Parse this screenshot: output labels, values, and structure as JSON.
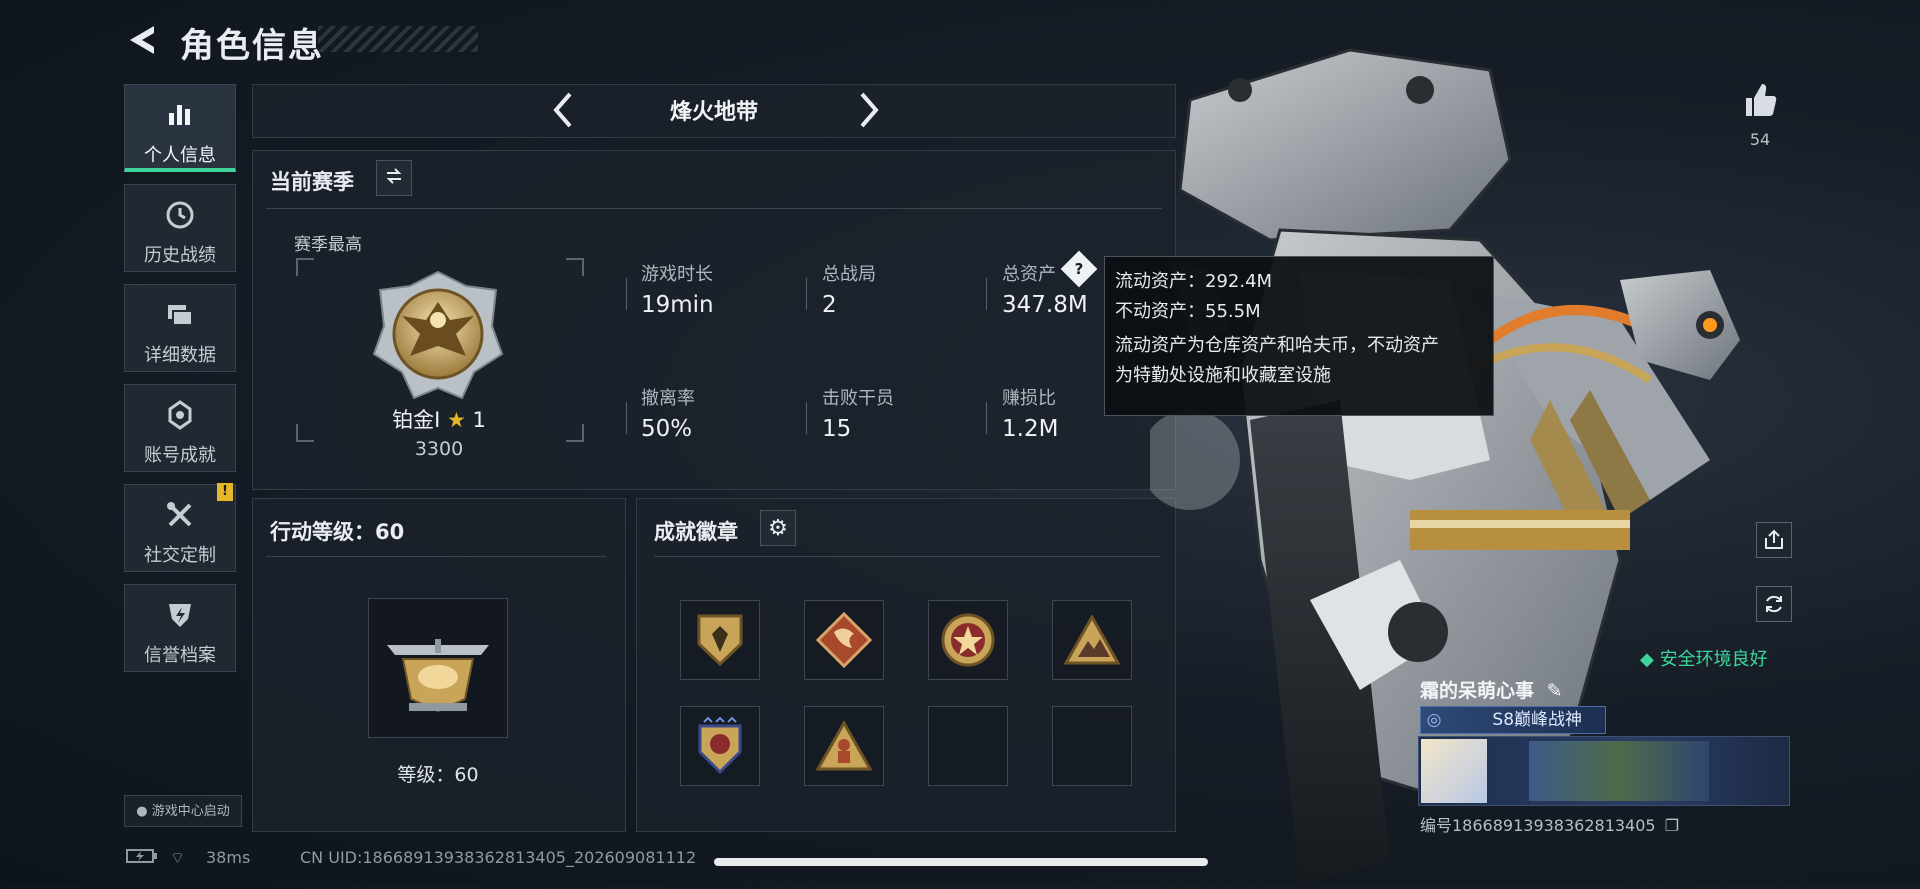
{
  "header": {
    "title": "角色信息"
  },
  "nav": [
    {
      "label": "个人信息",
      "icon": "bar-chart-icon",
      "active": true
    },
    {
      "label": "历史战绩",
      "icon": "clock-icon"
    },
    {
      "label": "详细数据",
      "icon": "folders-icon"
    },
    {
      "label": "账号成就",
      "icon": "emblem-icon"
    },
    {
      "label": "社交定制",
      "icon": "tools-icon",
      "badge": "!"
    },
    {
      "label": "信誉档案",
      "icon": "shield-bolt-icon"
    }
  ],
  "game_center": "游戏中心启动",
  "mode": {
    "name": "烽火地带"
  },
  "season": {
    "title": "当前赛季",
    "best_label": "赛季最高",
    "rank_name": "铂金I",
    "rank_stars": "1",
    "rank_score": "3300",
    "stats": [
      {
        "label": "游戏时长",
        "value": "19min"
      },
      {
        "label": "总战局",
        "value": "2"
      },
      {
        "label": "总资产",
        "value": "347.8M"
      },
      {
        "label": "撤离率",
        "value": "50%"
      },
      {
        "label": "击败干员",
        "value": "15"
      },
      {
        "label": "赚损比",
        "value": "1.2M"
      }
    ]
  },
  "tooltip": {
    "line1": "流动资产：292.4M",
    "line2": "不动资产：55.5M",
    "line3": "流动资产为仓库资产和哈夫币，不动资产",
    "line4": "为特勤处设施和收藏室设施"
  },
  "action_level": {
    "title": "行动等级：60",
    "level_text": "等级：60"
  },
  "achievements": {
    "title": "成就徽章",
    "badges": [
      "shield-badge",
      "dragon-badge",
      "star-badge",
      "mountain-badge",
      "wing-badge",
      "soldier-badge",
      "",
      ""
    ]
  },
  "likes": {
    "count": "54"
  },
  "safety": {
    "text": "安全环境良好"
  },
  "player": {
    "name": "霜的呆萌心事",
    "title": "S8巅峰战神",
    "id": "编号18668913938362813405"
  },
  "status_bar": {
    "ping": "38ms",
    "uid": "CN UID:18668913938362813405_202609081112"
  },
  "colors": {
    "accent": "#3cd69c",
    "warning": "#e6b62a",
    "gold": "#c9a55a"
  }
}
